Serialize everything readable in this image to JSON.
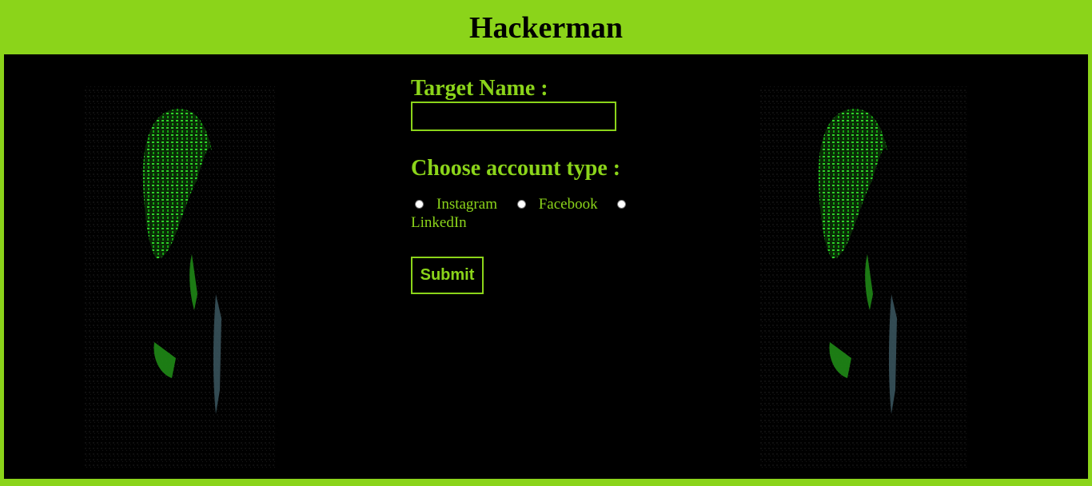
{
  "header": {
    "title": "Hackerman"
  },
  "form": {
    "target_label": "Target Name :",
    "target_value": "",
    "account_type_label": "Choose account type :",
    "options": [
      "Instagram",
      "Facebook",
      "LinkedIn"
    ],
    "submit_label": "Submit"
  },
  "colors": {
    "accent": "#8bd41a",
    "background": "#000000"
  }
}
